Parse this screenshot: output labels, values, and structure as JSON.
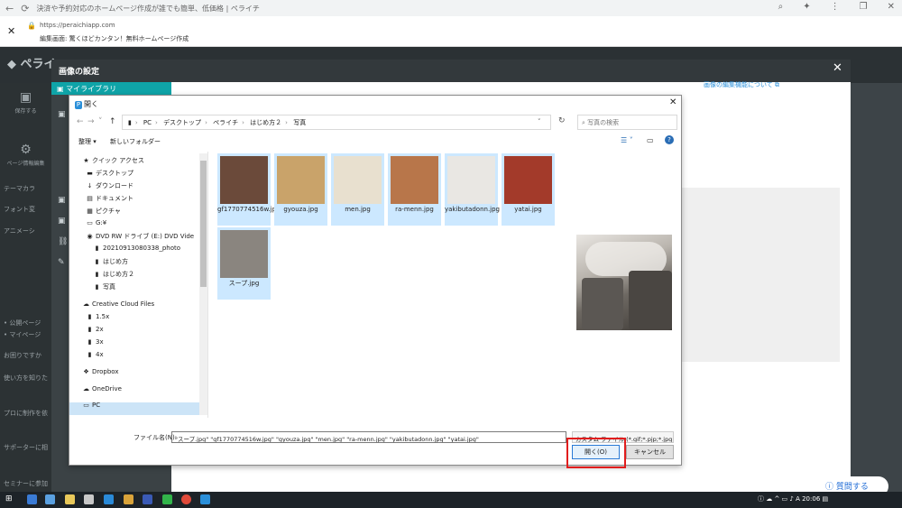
{
  "browser": {
    "title": "決済や予約対応のホームページ作成が誰でも簡単、低価格 | ペライチ",
    "url": "https://peraichiapp.com",
    "subtitle": "編集画面: 驚くほどカンタン！無料ホームページ作成"
  },
  "app": {
    "logo": "ペライ",
    "tools": [
      {
        "icon": "save-icon",
        "label": "保存する"
      },
      {
        "icon": "gear-icon",
        "label": "ページ情報編集"
      }
    ],
    "left_items": [
      "テーマカラ",
      "フォント変",
      "アニメーシ",
      "• 公開ページ",
      "• マイページ",
      "お困りですか",
      "使い方を知りた",
      "プロに制作を依",
      "サポーターに相",
      "セミナーに参加"
    ]
  },
  "modal": {
    "title": "画像の設定",
    "library_tab": "マイライブラリ",
    "edit_link": "画像の編集機能について"
  },
  "dialog": {
    "title": "開く",
    "breadcrumb": [
      "PC",
      "デスクトップ",
      "ペライチ",
      "はじめ方２",
      "写真"
    ],
    "search_placeholder": "写真の検索",
    "organize": "整理 ▾",
    "new_folder": "新しいフォルダー",
    "nav": [
      {
        "label": "クイック アクセス",
        "icon": "★",
        "pinned": false
      },
      {
        "label": "デスクトップ",
        "icon": "▬",
        "pinned": true
      },
      {
        "label": "ダウンロード",
        "icon": "↓",
        "pinned": true
      },
      {
        "label": "ドキュメント",
        "icon": "▤",
        "pinned": true
      },
      {
        "label": "ピクチャ",
        "icon": "▦",
        "pinned": true
      },
      {
        "label": "G:¥",
        "icon": "▭",
        "pinned": false
      },
      {
        "label": "DVD RW ドライブ (E:) DVD Vide",
        "icon": "◉",
        "pinned": true
      },
      {
        "label": "20210913080338_photo",
        "icon": "▮",
        "pinned": false
      },
      {
        "label": "はじめ方",
        "icon": "▮",
        "pinned": false
      },
      {
        "label": "はじめ方２",
        "icon": "▮",
        "pinned": false
      },
      {
        "label": "写真",
        "icon": "▮",
        "pinned": false
      },
      {
        "label": "Creative Cloud Files",
        "icon": "☁",
        "pinned": false
      },
      {
        "label": "1.5x",
        "icon": "▮",
        "pinned": false
      },
      {
        "label": "2x",
        "icon": "▮",
        "pinned": false
      },
      {
        "label": "3x",
        "icon": "▮",
        "pinned": false
      },
      {
        "label": "4x",
        "icon": "▮",
        "pinned": false
      },
      {
        "label": "Dropbox",
        "icon": "❖",
        "pinned": false
      },
      {
        "label": "OneDrive",
        "icon": "☁",
        "pinned": false
      },
      {
        "label": "PC",
        "icon": "▭",
        "pinned": false
      }
    ],
    "files": [
      {
        "name": "gf1770774516w.jpg",
        "color": "#6b4a3a"
      },
      {
        "name": "gyouza.jpg",
        "color": "#c9a36a"
      },
      {
        "name": "men.jpg",
        "color": "#e8e0cf"
      },
      {
        "name": "ra-menn.jpg",
        "color": "#b8764a"
      },
      {
        "name": "yakibutadonn.jpg",
        "color": "#e9e7e3"
      },
      {
        "name": "yatai.jpg",
        "color": "#a33a2a"
      },
      {
        "name": "スープ.jpg",
        "color": "#8a857f"
      }
    ],
    "filename_label": "ファイル名(N):",
    "filename_value": "\"スープ.jpg\" \"gf1770774516w.jpg\" \"gyouza.jpg\" \"men.jpg\" \"ra-menn.jpg\" \"yakibutadonn.jpg\" \"yatai.jpg\"",
    "filter": "カスタム ファイル (*.gif;*.pjp;*.jpg;*.",
    "open_label": "開く(O)",
    "cancel_label": "キャンセル"
  },
  "help_button": "質問する",
  "taskbar": {
    "time": "20:06"
  }
}
